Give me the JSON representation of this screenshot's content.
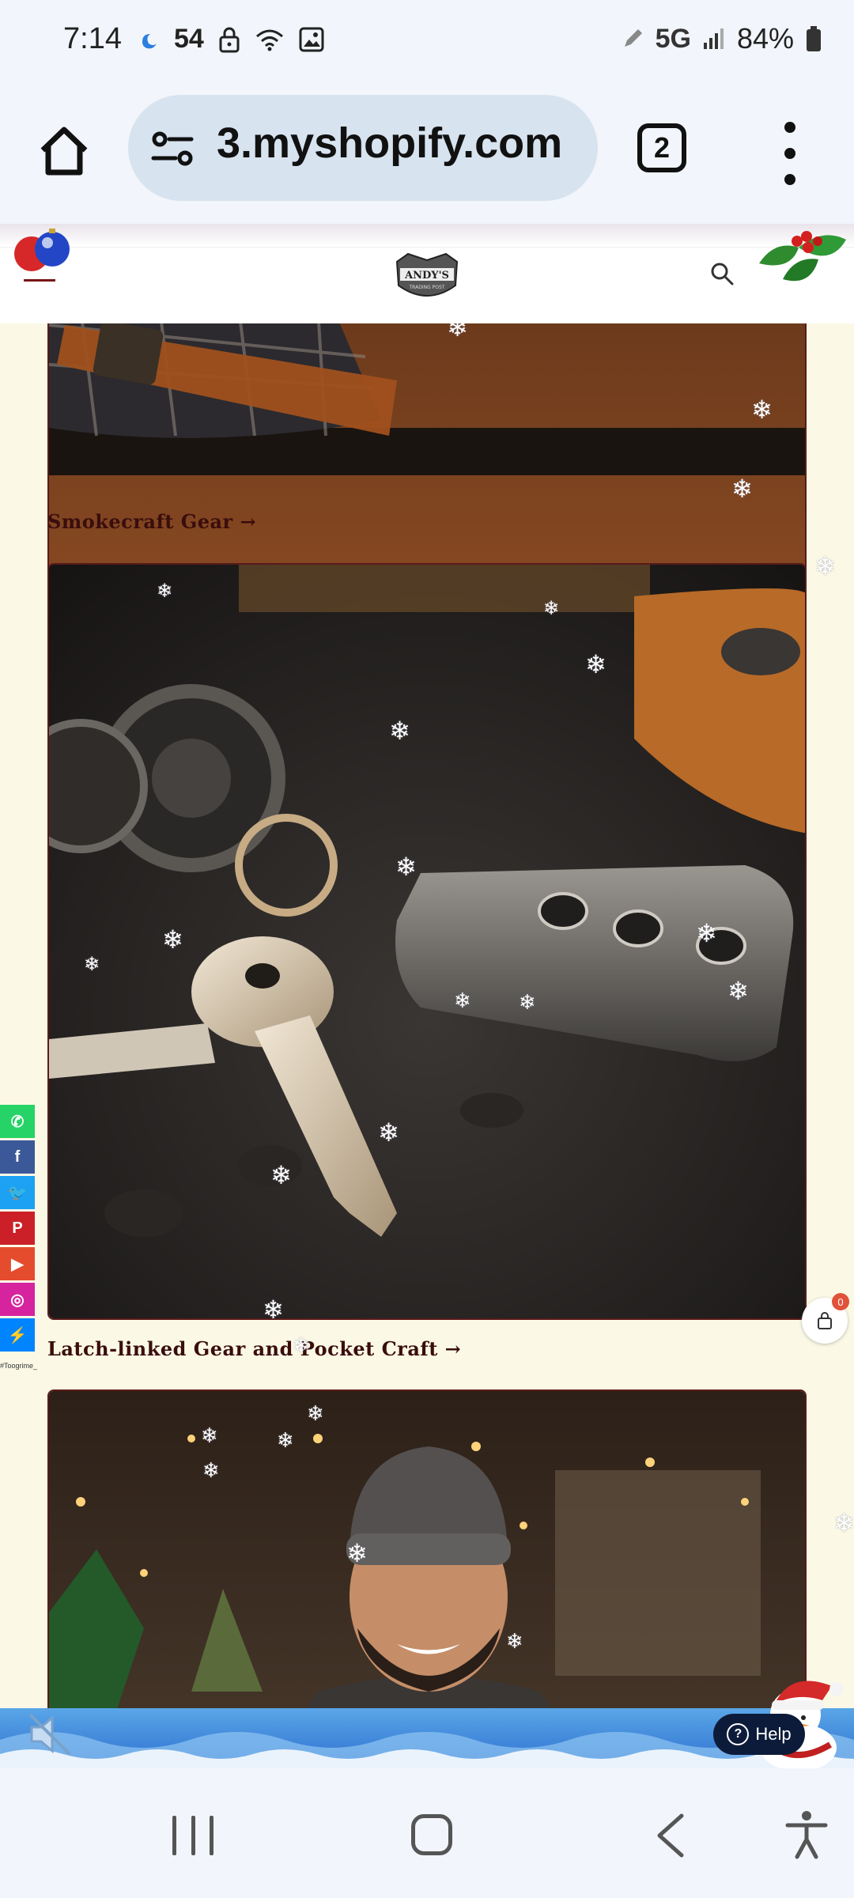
{
  "status_bar": {
    "time": "7:14",
    "temperature": "54",
    "network": "5G",
    "battery": "84%"
  },
  "browser": {
    "url": "3.myshopify.com",
    "tab_count": "2"
  },
  "site": {
    "logo_text": "ANDY'S",
    "logo_subtext": "TRADING POST"
  },
  "collections": [
    {
      "caption": "Smokecraft Gear →"
    },
    {
      "caption": "Latch-linked Gear and Pocket Craft →"
    }
  ],
  "social": {
    "items": [
      "whatsapp",
      "facebook",
      "twitter",
      "pinterest",
      "youtube",
      "instagram",
      "messenger"
    ],
    "label": "#Toogrime_"
  },
  "cart": {
    "count": "0"
  },
  "help": {
    "label": "Help"
  },
  "colors": {
    "page_background": "#fbf9e6",
    "caption_color": "#3a0d0d",
    "card_border": "#5a1a1a",
    "help_button": "#0d1b3a"
  }
}
